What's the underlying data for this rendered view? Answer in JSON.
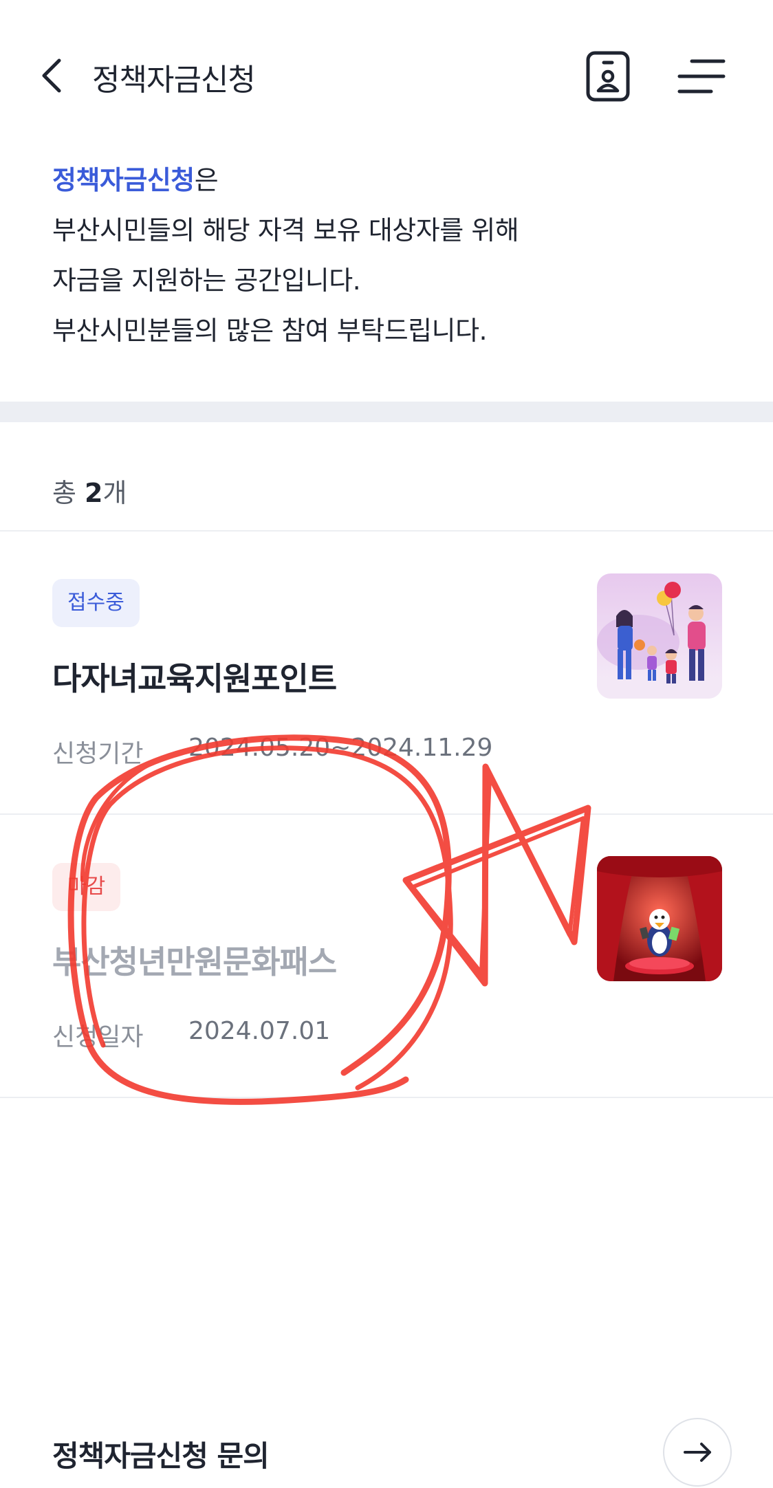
{
  "header": {
    "title": "정책자금신청",
    "icons": [
      "back-arrow-icon",
      "id-card-icon",
      "menu-icon"
    ]
  },
  "intro": {
    "highlight": "정책자금신청",
    "highlight_suffix": "은",
    "line2": "부산시민들의 해당 자격 보유 대상자를 위해",
    "line3": "자금을 지원하는 공간입니다.",
    "line4": "부산시민분들의 많은 참여 부탁드립니다."
  },
  "list": {
    "total_prefix": "총 ",
    "total_count": "2",
    "total_suffix": "개",
    "items": [
      {
        "badge": "접수중",
        "title": "다자녀교육지원포인트",
        "period_label": "신청기간",
        "period_value": "2024.05.20~2024.11.29"
      },
      {
        "badge": "마감",
        "title": "부산청년만원문화패스",
        "period_label": "신청일자",
        "period_value": "2024.07.01"
      }
    ]
  },
  "footer": {
    "title": "정책자금신청 문의"
  },
  "colors": {
    "accent": "#3a5bd9",
    "closed": "#e74a4a",
    "annotation": "#f23a2f"
  }
}
